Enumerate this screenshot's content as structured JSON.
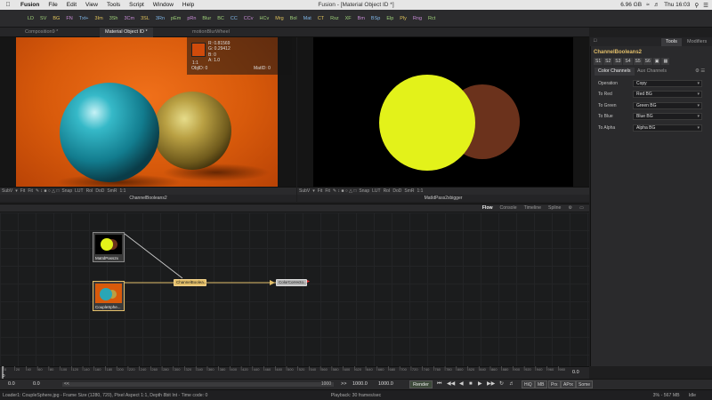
{
  "menubar": {
    "app": "Fusion",
    "items": [
      "File",
      "Edit",
      "View",
      "Tools",
      "Script",
      "Window",
      "Help"
    ],
    "title": "Fusion - [Material Object ID *]",
    "storage": "6.96 GB",
    "clock": "Thu 16:03"
  },
  "toolbar": {
    "items": [
      "LD",
      "SV",
      "BG",
      "FN",
      "Txt+",
      "3Im",
      "3Sh",
      "3Cm",
      "3SL",
      "3Rn",
      "pEm",
      "pRn",
      "Blur",
      "BC",
      "CC",
      "CCv",
      "HCv",
      "Mrg",
      "Bol",
      "Mat",
      "CT",
      "Rsz",
      "XF",
      "Bm",
      "BSp",
      "Elp",
      "Ply",
      "Rng",
      "Rct"
    ]
  },
  "viewtabs": {
    "tabs": [
      "Composition9 *",
      "Material Object ID *",
      "motionBlurWheel"
    ]
  },
  "picker": {
    "r": "R: 0.81569",
    "g": "G: 0.29412",
    "b": "B: 0",
    "a": "A: 1.0",
    "scale": "1:1",
    "objid": "ObjID: 0",
    "matid": "MatID: 0"
  },
  "viewer_controls": {
    "subv": "SubV",
    "fit": "Fit",
    "snap": "Snap",
    "lut": "LUT",
    "roi": "RoI",
    "dod": "DoD",
    "smr": "SmR",
    "scale": "1:1"
  },
  "viewers": {
    "left_name": "ChannelBooleans2",
    "right_name": "MatIdPass2xbigger"
  },
  "inspector": {
    "tabs": [
      "Tools",
      "Modifiers"
    ],
    "tool_name": "ChannelBooleans2",
    "subtabs": [
      "S1",
      "S2",
      "S3",
      "S4",
      "S5",
      "S6"
    ],
    "channel_tabs": [
      "Color Channels",
      "Aux Channels"
    ],
    "params": [
      {
        "label": "Operation",
        "value": "Copy"
      },
      {
        "label": "To Red",
        "value": "Red  BG"
      },
      {
        "label": "To Green",
        "value": "Green  BG"
      },
      {
        "label": "To Blue",
        "value": "Blue  BG"
      },
      {
        "label": "To Alpha",
        "value": "Alpha  BG"
      }
    ]
  },
  "flow": {
    "tabs": [
      "Flow",
      "Console",
      "Timeline",
      "Spline"
    ],
    "nodes": {
      "matid": "MatIdPass2x",
      "couple": "CoupleSphe...",
      "chbool": "ChannelBoolea...",
      "colorcorr": "ColorCorrecto..."
    }
  },
  "timeline": {
    "start": "0",
    "end": "0.0",
    "ticks": [
      "0",
      "20",
      "40",
      "60",
      "80",
      "100",
      "120",
      "140",
      "160",
      "180",
      "200",
      "220",
      "240",
      "260",
      "280",
      "300",
      "320",
      "340",
      "360",
      "380",
      "400",
      "420",
      "440",
      "460",
      "480",
      "500",
      "520",
      "540",
      "560",
      "580",
      "600",
      "620",
      "640",
      "660",
      "680",
      "700",
      "720",
      "740",
      "760",
      "780",
      "800",
      "820",
      "840",
      "860",
      "880",
      "900",
      "920",
      "940",
      "960",
      "980"
    ]
  },
  "transport": {
    "current": "0.0",
    "render_start": "0.0",
    "range_end": "1000",
    "global_end": "1000.0",
    "render_end": "1000.0",
    "render": "Render",
    "hiq": "HiQ",
    "mb": "MB",
    "prx": "Prx",
    "aprx": "APrx",
    "some": "Some",
    "range_marker_left": "<<",
    "range_marker_right": ">>"
  },
  "status": {
    "left": "Loader1: CoupleSphere.jpg - Frame Size (1280, 720), Pixel Aspect 1:1, Depth 8bit Int - Time code: 0",
    "center": "Playback: 30 frames/sec",
    "mem": "3% - 567 MB",
    "state": "Idle"
  },
  "colors": {
    "orange_bg": "#d85a0b",
    "yellow_disc": "#e3f21a",
    "brown_disc": "#6b321c",
    "node_selected": "#e3bf6a"
  }
}
